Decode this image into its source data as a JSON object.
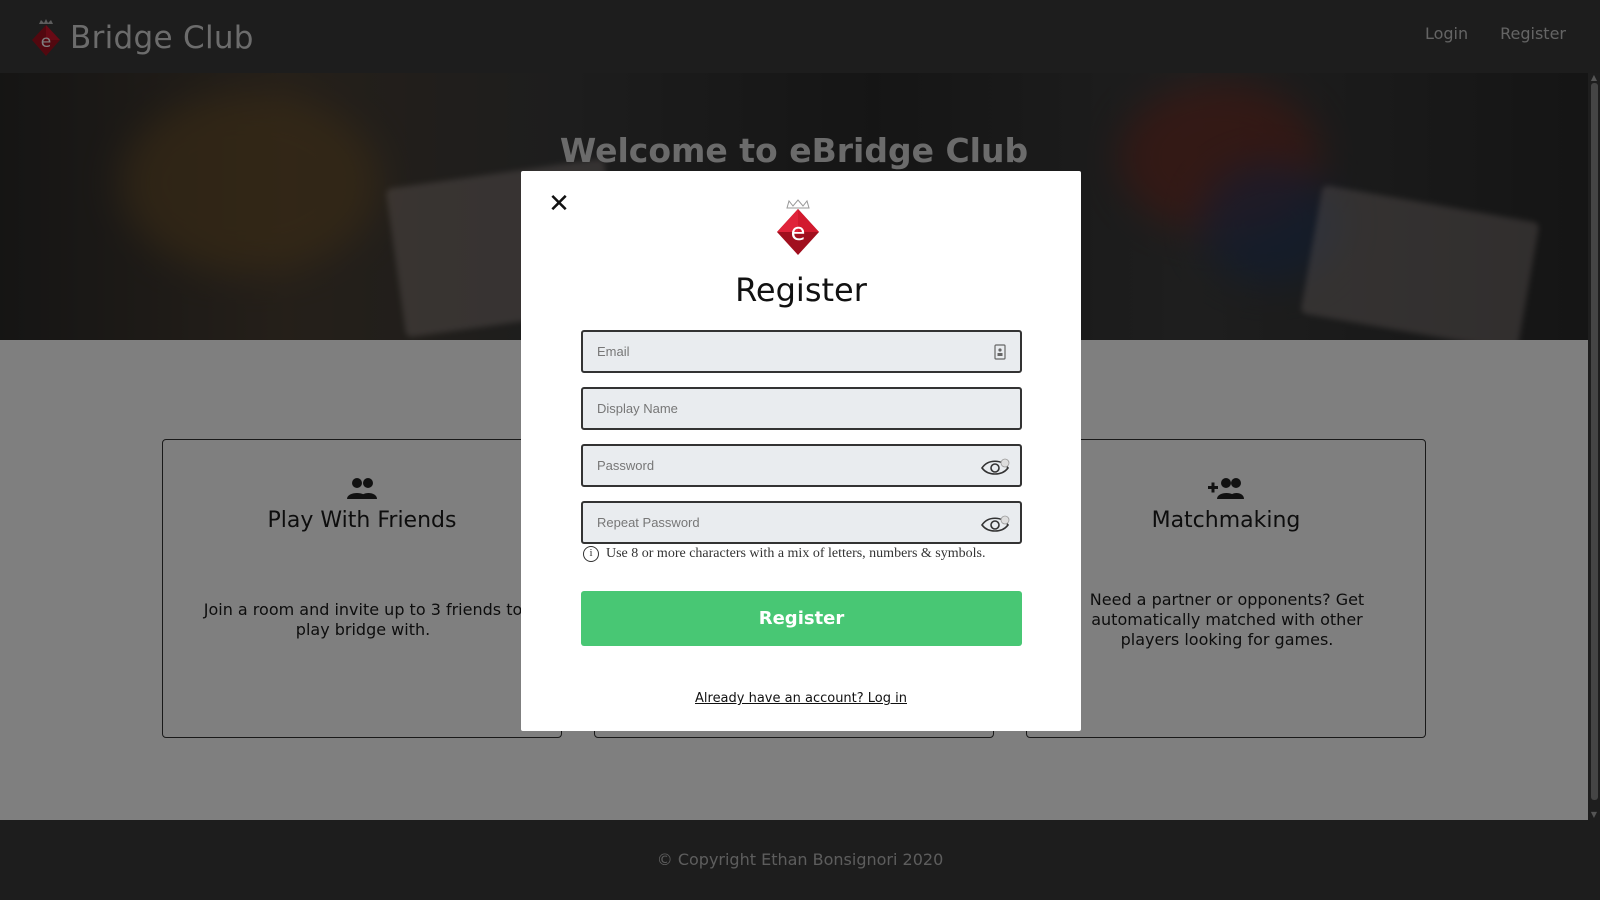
{
  "navbar": {
    "brand_text": "Bridge Club",
    "links": [
      "Login",
      "Register"
    ]
  },
  "hero": {
    "title": "Welcome to eBridge Club"
  },
  "features": [
    {
      "icon": "users-icon",
      "title": "Play With Friends",
      "description": "Join a room and invite up to 3 friends to play bridge with."
    },
    {
      "icon": "user-plus-icon",
      "title": "Matchmaking",
      "description": "Need a partner or opponents? Get automatically matched with other players looking for games."
    }
  ],
  "footer": {
    "text": "© Copyright Ethan Bonsignori 2020"
  },
  "modal": {
    "close_symbol": "✕",
    "title": "Register",
    "fields": {
      "email_placeholder": "Email",
      "display_name_placeholder": "Display Name",
      "password_placeholder": "Password",
      "repeat_password_placeholder": "Repeat Password"
    },
    "hint_icon": "i",
    "hint_text": "Use 8 or more characters with a mix of letters, numbers & symbols.",
    "submit_label": "Register",
    "login_link": "Already have an account? Log in"
  },
  "colors": {
    "navbar_bg": "#3a3a3a",
    "submit_green": "#48c774",
    "logo_red": "#c8102e"
  }
}
